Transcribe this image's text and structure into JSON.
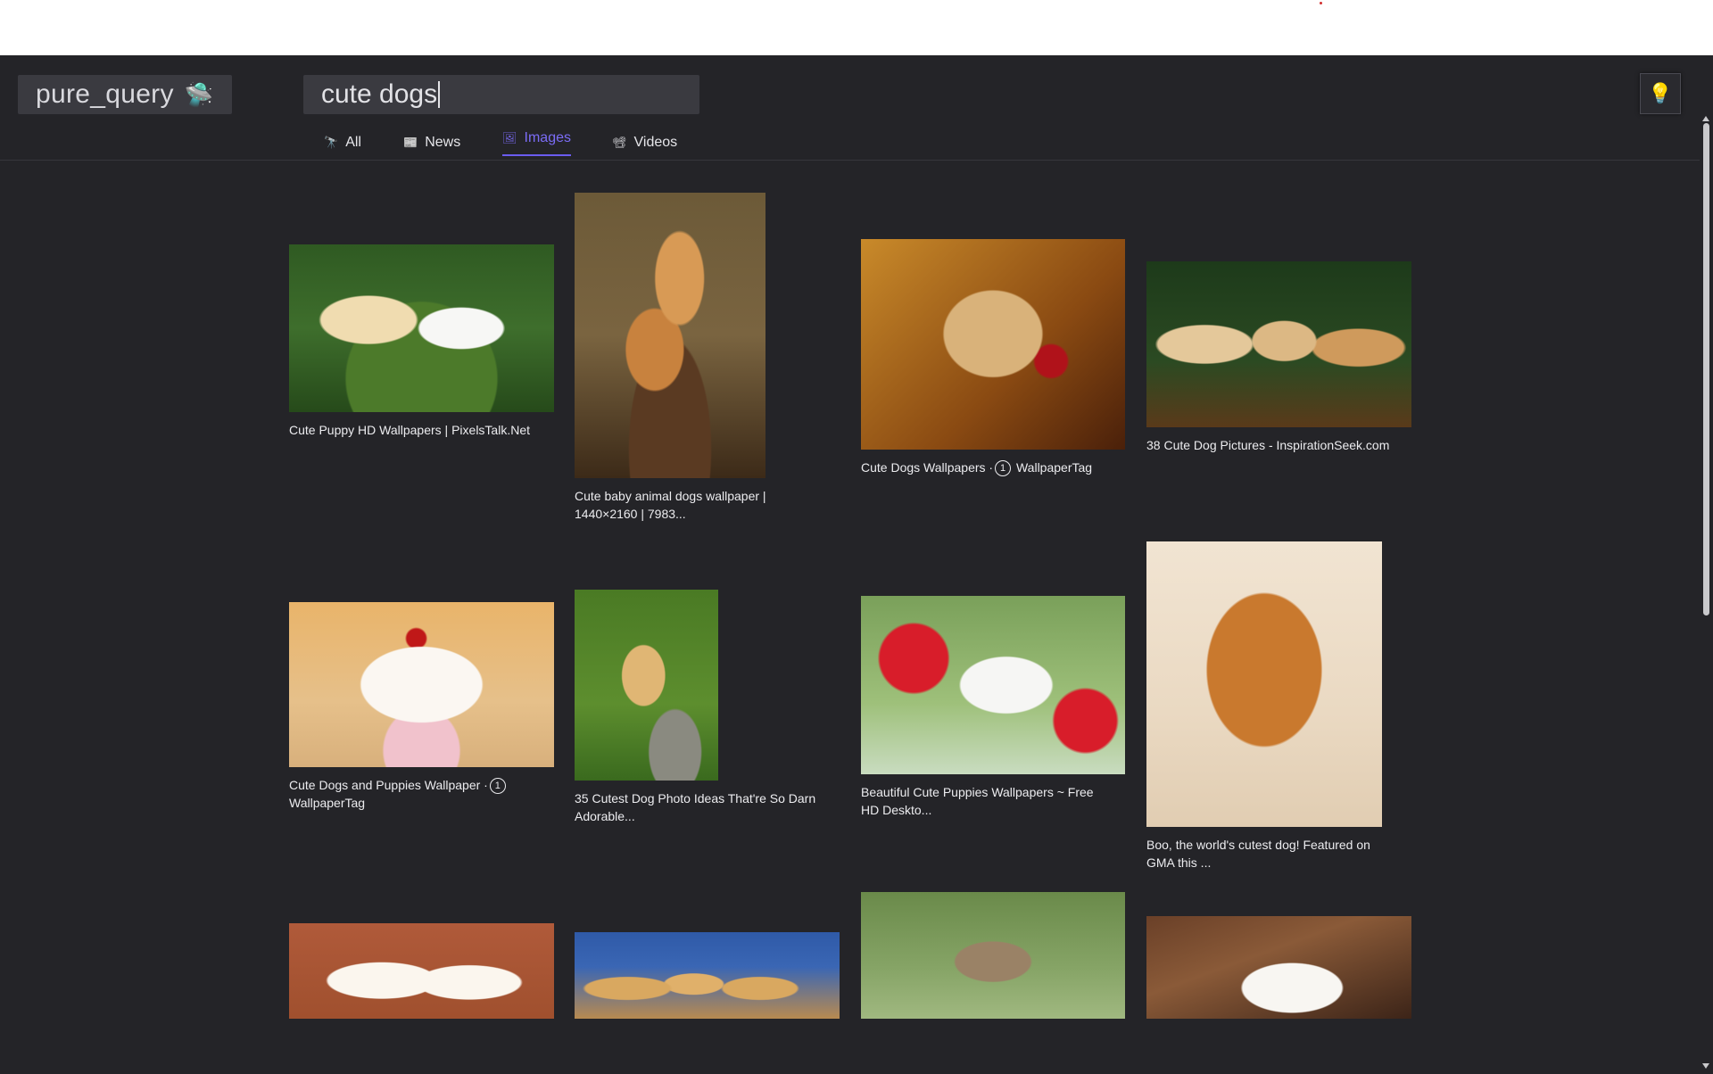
{
  "logo": {
    "text": "pure_query",
    "icon": "ufo-icon",
    "icon_glyph": "🛸"
  },
  "search": {
    "value": "cute dogs"
  },
  "theme_toggle": {
    "icon": "lightbulb-icon",
    "glyph": "💡"
  },
  "tabs": [
    {
      "label": "All",
      "icon": "telescope-icon",
      "glyph": "🔭",
      "active": false
    },
    {
      "label": "News",
      "icon": "newspaper-icon",
      "glyph": "📰",
      "active": false
    },
    {
      "label": "Images",
      "icon": "images-icon",
      "glyph": "🖼",
      "active": true
    },
    {
      "label": "Videos",
      "icon": "video-camera-icon",
      "glyph": "📽",
      "active": false
    }
  ],
  "results": [
    {
      "caption": "Cute Puppy HD Wallpapers | PixelsTalk.Net"
    },
    {
      "caption_line1": "Cute baby animal dogs wallpaper |",
      "caption_line2": "1440×2160 | 7983..."
    },
    {
      "caption_before": "Cute Dogs Wallpapers ·",
      "caption_circle": "1",
      "caption_after": " WallpaperTag"
    },
    {
      "caption": "38 Cute Dog Pictures - InspirationSeek.com"
    },
    {
      "caption_before": "Cute Dogs and Puppies Wallpaper ·",
      "caption_circle": "1",
      "caption_line2": "WallpaperTag"
    },
    {
      "caption_line1": "35 Cutest Dog Photo Ideas That're So Darn",
      "caption_line2": "Adorable..."
    },
    {
      "caption_line1": "Beautiful Cute Puppies Wallpapers ~ Free",
      "caption_line2": "HD Deskto..."
    },
    {
      "caption_line1": "Boo, the world's cutest dog! Featured on",
      "caption_line2": "GMA this ..."
    },
    {
      "caption": ""
    },
    {
      "caption": ""
    },
    {
      "caption": ""
    },
    {
      "caption": ""
    }
  ],
  "colors": {
    "background": "#242428",
    "field": "#3a3a40",
    "accent": "#6b5cf0"
  }
}
